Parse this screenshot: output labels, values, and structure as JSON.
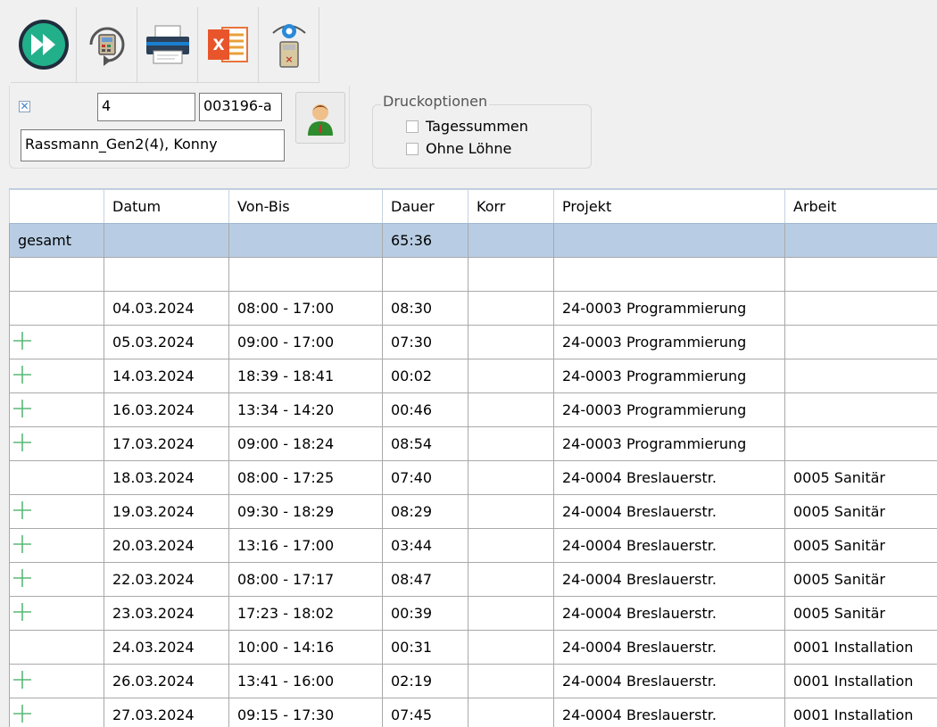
{
  "toolbar": {
    "buttons": [
      {
        "name": "run-button",
        "icon": "fast-forward-icon"
      },
      {
        "name": "recalculate-button",
        "icon": "refresh-calculator-icon"
      },
      {
        "name": "print-button",
        "icon": "printer-icon"
      },
      {
        "name": "excel-export-button",
        "icon": "excel-icon"
      },
      {
        "name": "preview-button",
        "icon": "eye-calculator-icon"
      }
    ]
  },
  "filter": {
    "checkbox_mark": "✕",
    "number_value": "4",
    "code_value": "003196-a",
    "employee_value": "Rassmann_Gen2(4), Konny"
  },
  "print_options": {
    "title": "Druckoptionen",
    "daily_totals": "Tagessummen",
    "without_wages": "Ohne Löhne"
  },
  "table": {
    "columns": [
      "",
      "Datum",
      "Von-Bis",
      "Dauer",
      "Korr",
      "Projekt",
      "Arbeit"
    ],
    "total": {
      "label": "gesamt",
      "dauer": "65:36"
    },
    "rows": [
      {
        "plus": false,
        "datum": "04.03.2024",
        "von_bis": "08:00 - 17:00",
        "dauer": "08:30",
        "korr": "",
        "projekt": "24-0003 Programmierung",
        "arbeit": ""
      },
      {
        "plus": true,
        "datum": "05.03.2024",
        "von_bis": "09:00 - 17:00",
        "dauer": "07:30",
        "korr": "",
        "projekt": "24-0003 Programmierung",
        "arbeit": ""
      },
      {
        "plus": true,
        "datum": "14.03.2024",
        "von_bis": "18:39 - 18:41",
        "dauer": "00:02",
        "korr": "",
        "projekt": "24-0003 Programmierung",
        "arbeit": ""
      },
      {
        "plus": true,
        "datum": "16.03.2024",
        "von_bis": "13:34 - 14:20",
        "dauer": "00:46",
        "korr": "",
        "projekt": "24-0003 Programmierung",
        "arbeit": ""
      },
      {
        "plus": true,
        "datum": "17.03.2024",
        "von_bis": "09:00 - 18:24",
        "dauer": "08:54",
        "korr": "",
        "projekt": "24-0003 Programmierung",
        "arbeit": ""
      },
      {
        "plus": false,
        "datum": "18.03.2024",
        "von_bis": "08:00 - 17:25",
        "dauer": "07:40",
        "korr": "",
        "projekt": "24-0004 Breslauerstr.",
        "arbeit": "0005 Sanitär"
      },
      {
        "plus": true,
        "datum": "19.03.2024",
        "von_bis": "09:30 - 18:29",
        "dauer": "08:29",
        "korr": "",
        "projekt": "24-0004 Breslauerstr.",
        "arbeit": "0005 Sanitär"
      },
      {
        "plus": true,
        "datum": "20.03.2024",
        "von_bis": "13:16 - 17:00",
        "dauer": "03:44",
        "korr": "",
        "projekt": "24-0004 Breslauerstr.",
        "arbeit": "0005 Sanitär"
      },
      {
        "plus": true,
        "datum": "22.03.2024",
        "von_bis": "08:00 - 17:17",
        "dauer": "08:47",
        "korr": "",
        "projekt": "24-0004 Breslauerstr.",
        "arbeit": "0005 Sanitär"
      },
      {
        "plus": true,
        "datum": "23.03.2024",
        "von_bis": "17:23 - 18:02",
        "dauer": "00:39",
        "korr": "",
        "projekt": "24-0004 Breslauerstr.",
        "arbeit": "0005 Sanitär"
      },
      {
        "plus": false,
        "datum": "24.03.2024",
        "von_bis": "10:00 - 14:16",
        "dauer": "00:31",
        "korr": "",
        "projekt": "24-0004 Breslauerstr.",
        "arbeit": "0001 Installation"
      },
      {
        "plus": true,
        "datum": "26.03.2024",
        "von_bis": "13:41 - 16:00",
        "dauer": "02:19",
        "korr": "",
        "projekt": "24-0004 Breslauerstr.",
        "arbeit": "0001 Installation"
      },
      {
        "plus": true,
        "datum": "27.03.2024",
        "von_bis": "09:15 - 17:30",
        "dauer": "07:45",
        "korr": "",
        "projekt": "24-0004 Breslauerstr.",
        "arbeit": "0001 Installation"
      }
    ]
  },
  "colors": {
    "selection": "#b8cde4",
    "plus_icon": "#58b878",
    "run_button": "#22b08a"
  }
}
